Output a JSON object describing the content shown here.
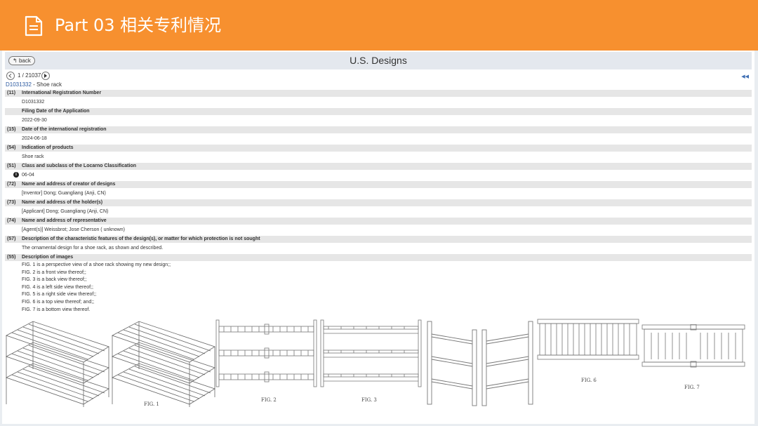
{
  "slide": {
    "title": "Part 03  相关专利情况"
  },
  "topbar": {
    "back_label": "back",
    "heading": "U.S. Designs"
  },
  "pager": {
    "count": "1 / 21037"
  },
  "record": {
    "id": "D1031332",
    "title": " - Shoe rack"
  },
  "fields": [
    {
      "code": "(11)",
      "label": "International Registration Number",
      "value": "D1031332"
    },
    {
      "code": "",
      "label": "Filing Date of the Application",
      "value": "2022-09-30"
    },
    {
      "code": "(15)",
      "label": "Date of the international registration",
      "value": "2024-06-18"
    },
    {
      "code": "(54)",
      "label": "Indication of products",
      "value": "Shoe rack"
    },
    {
      "code": "(51)",
      "label": "Class and subclass of the Locarno Classification",
      "value": "06-04"
    },
    {
      "code": "(72)",
      "label": "Name and address of creator of designs",
      "value": "[Inventor] Dong; Guangliang (Anji, CN)"
    },
    {
      "code": "(73)",
      "label": "Name and address of the holder(s)",
      "value": "[Applicant]  Dong; Guangliang (Anji, CN)"
    },
    {
      "code": "(74)",
      "label": "Name and address of representative",
      "value": "[Agent(s)] Weissbrot; Jose Cherson ( unknown)"
    },
    {
      "code": "(57)",
      "label": "Description of the characteristic features of the design(s), or matter for which protection is not sought",
      "value": "The ornamental design for a shoe rack, as shown and described."
    }
  ],
  "images_section": {
    "code": "(55)",
    "label": "Description of images",
    "lines": [
      "FIG. 1 is a perspective view of a shoe rack showing my new design;;",
      "FIG. 2 is a front view thereof;;",
      "FIG. 3 is a back view thereof;;",
      "FIG. 4 is a left side view thereof;;",
      "FIG. 5 is a right side view thereof;;",
      "FIG. 6 is a top view thereof; and;;",
      "FIG. 7 is a bottom view thereof."
    ]
  },
  "figures": {
    "fig1": "FIG. 1",
    "fig2": "FIG. 2",
    "fig3": "FIG. 3",
    "fig6": "FIG. 6",
    "fig7": "FIG. 7"
  },
  "colors": {
    "header": "#f7902f",
    "panel": "#ffffff",
    "link": "#2c5aa0"
  },
  "icons": {
    "slide_icon": "document-icon",
    "info": "info-icon",
    "prev": "arrow-left-icon",
    "next": "arrow-right-icon"
  }
}
